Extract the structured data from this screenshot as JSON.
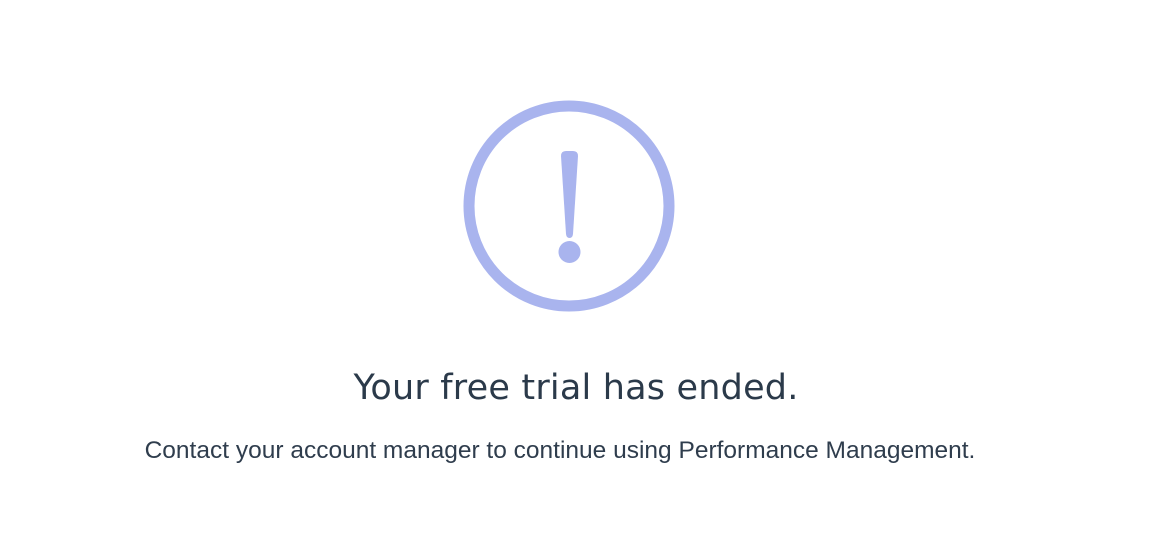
{
  "trial_notice": {
    "icon": "exclamation-circle-icon",
    "icon_color": "#a9b4ee",
    "title": "Your free trial has ended.",
    "message": "Contact your account manager to continue using Performance Management."
  }
}
